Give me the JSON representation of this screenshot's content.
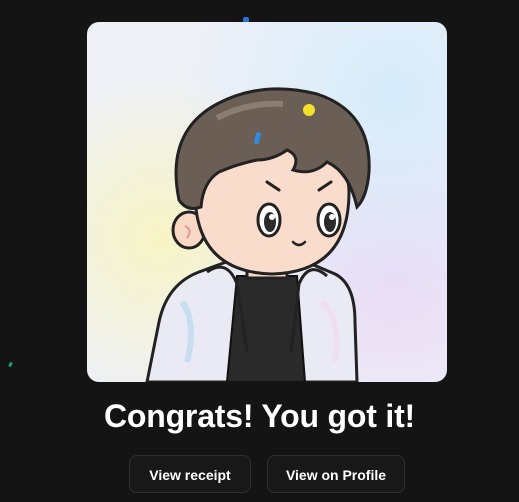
{
  "headline": "Congrats! You got it!",
  "buttons": {
    "view_receipt": "View receipt",
    "view_profile": "View on Profile"
  },
  "colors": {
    "background": "#141414",
    "button_bg": "#181818",
    "button_border": "#303030",
    "text": "#ffffff"
  },
  "image": {
    "subject": "cartoon-boy-avatar-nft"
  }
}
